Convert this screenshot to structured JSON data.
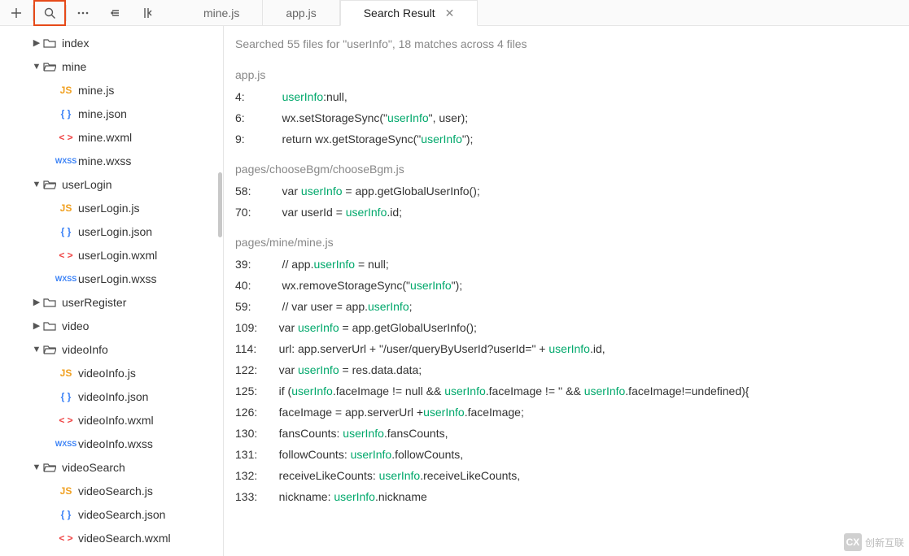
{
  "toolbar": {
    "icons": [
      "add",
      "search",
      "more",
      "filter",
      "collapse"
    ]
  },
  "tabs": [
    {
      "label": "mine.js",
      "active": false
    },
    {
      "label": "app.js",
      "active": false
    },
    {
      "label": "Search Result",
      "active": true,
      "closable": true
    }
  ],
  "tree": [
    {
      "depth": 1,
      "chev": "▶",
      "icon": "folder",
      "label": "index"
    },
    {
      "depth": 1,
      "chev": "▼",
      "icon": "folder-open",
      "label": "mine"
    },
    {
      "depth": 2,
      "chev": "",
      "icon": "js",
      "label": "mine.js"
    },
    {
      "depth": 2,
      "chev": "",
      "icon": "json",
      "label": "mine.json"
    },
    {
      "depth": 2,
      "chev": "",
      "icon": "wxml",
      "label": "mine.wxml"
    },
    {
      "depth": 2,
      "chev": "",
      "icon": "wxss",
      "label": "mine.wxss"
    },
    {
      "depth": 1,
      "chev": "▼",
      "icon": "folder-open",
      "label": "userLogin"
    },
    {
      "depth": 2,
      "chev": "",
      "icon": "js",
      "label": "userLogin.js"
    },
    {
      "depth": 2,
      "chev": "",
      "icon": "json",
      "label": "userLogin.json"
    },
    {
      "depth": 2,
      "chev": "",
      "icon": "wxml",
      "label": "userLogin.wxml"
    },
    {
      "depth": 2,
      "chev": "",
      "icon": "wxss",
      "label": "userLogin.wxss"
    },
    {
      "depth": 1,
      "chev": "▶",
      "icon": "folder",
      "label": "userRegister"
    },
    {
      "depth": 1,
      "chev": "▶",
      "icon": "folder",
      "label": "video"
    },
    {
      "depth": 1,
      "chev": "▼",
      "icon": "folder-open",
      "label": "videoInfo"
    },
    {
      "depth": 2,
      "chev": "",
      "icon": "js",
      "label": "videoInfo.js"
    },
    {
      "depth": 2,
      "chev": "",
      "icon": "json",
      "label": "videoInfo.json"
    },
    {
      "depth": 2,
      "chev": "",
      "icon": "wxml",
      "label": "videoInfo.wxml"
    },
    {
      "depth": 2,
      "chev": "",
      "icon": "wxss",
      "label": "videoInfo.wxss"
    },
    {
      "depth": 1,
      "chev": "▼",
      "icon": "folder-open",
      "label": "videoSearch"
    },
    {
      "depth": 2,
      "chev": "",
      "icon": "js",
      "label": "videoSearch.js"
    },
    {
      "depth": 2,
      "chev": "",
      "icon": "json",
      "label": "videoSearch.json"
    },
    {
      "depth": 2,
      "chev": "",
      "icon": "wxml",
      "label": "videoSearch.wxml"
    }
  ],
  "search": {
    "summary": "Searched 55 files for \"userInfo\", 18 matches across 4 files",
    "keyword": "userInfo",
    "groups": [
      {
        "file": "app.js",
        "lines": [
          {
            "n": "4:",
            "segs": [
              [
                "",
                "    "
              ],
              [
                "hl",
                "userInfo"
              ],
              [
                "",
                ":null,"
              ]
            ]
          },
          {
            "n": "6:",
            "segs": [
              [
                "",
                "    wx.setStorageSync(\""
              ],
              [
                "hl",
                "userInfo"
              ],
              [
                "",
                "\", user);"
              ]
            ]
          },
          {
            "n": "9:",
            "segs": [
              [
                "",
                "    return wx.getStorageSync(\""
              ],
              [
                "hl",
                "userInfo"
              ],
              [
                "",
                "\");"
              ]
            ]
          }
        ]
      },
      {
        "file": "pages/chooseBgm/chooseBgm.js",
        "lines": [
          {
            "n": "58:",
            "segs": [
              [
                "",
                "    var "
              ],
              [
                "hl",
                "userInfo"
              ],
              [
                "",
                " = app.getGlobalUserInfo();"
              ]
            ]
          },
          {
            "n": "70:",
            "segs": [
              [
                "",
                "    var userId = "
              ],
              [
                "hl",
                "userInfo"
              ],
              [
                "",
                ".id;"
              ]
            ]
          }
        ]
      },
      {
        "file": "pages/mine/mine.js",
        "lines": [
          {
            "n": "39:",
            "segs": [
              [
                "",
                "    // app."
              ],
              [
                "hl",
                "userInfo"
              ],
              [
                "",
                " = null;"
              ]
            ]
          },
          {
            "n": "40:",
            "segs": [
              [
                "",
                "    wx.removeStorageSync(\""
              ],
              [
                "hl",
                "userInfo"
              ],
              [
                "",
                "\");"
              ]
            ]
          },
          {
            "n": "59:",
            "segs": [
              [
                "",
                "    // var user = app."
              ],
              [
                "hl",
                "userInfo"
              ],
              [
                "",
                ";"
              ]
            ]
          },
          {
            "n": "109:",
            "segs": [
              [
                "",
                "   var "
              ],
              [
                "hl",
                "userInfo"
              ],
              [
                "",
                " = app.getGlobalUserInfo();"
              ]
            ]
          },
          {
            "n": "114:",
            "segs": [
              [
                "",
                "   url: app.serverUrl + \"/user/queryByUserId?userId=\" + "
              ],
              [
                "hl",
                "userInfo"
              ],
              [
                "",
                ".id,"
              ]
            ]
          },
          {
            "n": "122:",
            "segs": [
              [
                "",
                "   var "
              ],
              [
                "hl",
                "userInfo"
              ],
              [
                "",
                " = res.data.data;"
              ]
            ]
          },
          {
            "n": "125:",
            "segs": [
              [
                "",
                "   if ("
              ],
              [
                "hl",
                "userInfo"
              ],
              [
                "",
                ".faceImage != null && "
              ],
              [
                "hl",
                "userInfo"
              ],
              [
                "",
                ".faceImage != '' && "
              ],
              [
                "hl",
                "userInfo"
              ],
              [
                "",
                ".faceImage!=undefined){"
              ]
            ]
          },
          {
            "n": "126:",
            "segs": [
              [
                "",
                "   faceImage = app.serverUrl +"
              ],
              [
                "hl",
                "userInfo"
              ],
              [
                "",
                ".faceImage;"
              ]
            ]
          },
          {
            "n": "130:",
            "segs": [
              [
                "",
                "   fansCounts: "
              ],
              [
                "hl",
                "userInfo"
              ],
              [
                "",
                ".fansCounts,"
              ]
            ]
          },
          {
            "n": "131:",
            "segs": [
              [
                "",
                "   followCounts: "
              ],
              [
                "hl",
                "userInfo"
              ],
              [
                "",
                ".followCounts,"
              ]
            ]
          },
          {
            "n": "132:",
            "segs": [
              [
                "",
                "   receiveLikeCounts: "
              ],
              [
                "hl",
                "userInfo"
              ],
              [
                "",
                ".receiveLikeCounts,"
              ]
            ]
          },
          {
            "n": "133:",
            "segs": [
              [
                "",
                "   nickname: "
              ],
              [
                "hl",
                "userInfo"
              ],
              [
                "",
                ".nickname"
              ]
            ]
          }
        ]
      }
    ]
  },
  "watermark": "创新互联"
}
